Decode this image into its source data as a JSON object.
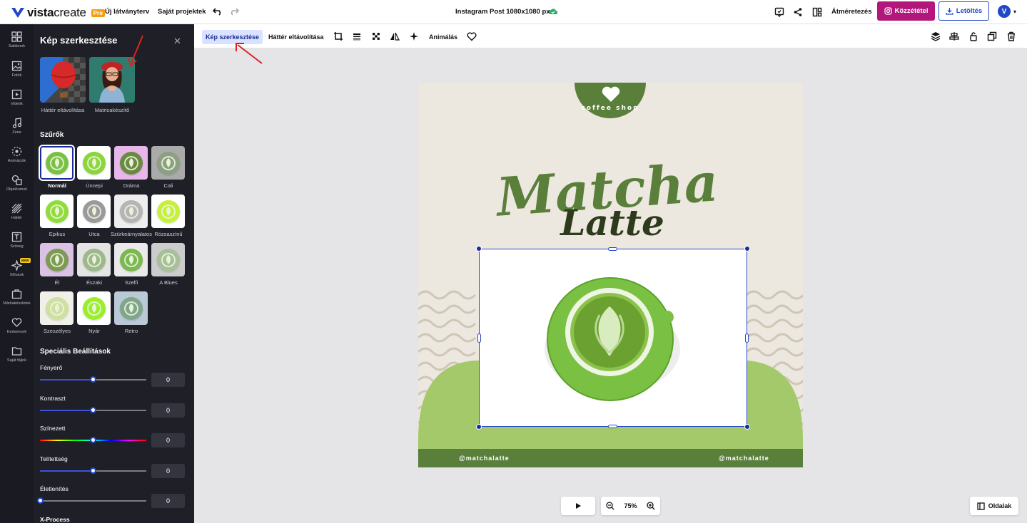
{
  "topbar": {
    "logo_main": "vista",
    "logo_sub": "create",
    "pro_badge": "Pro",
    "new_design": "Új látványterv",
    "my_projects": "Saját projektek",
    "doc_title": "Instagram Post 1080x1080 px",
    "resize": "Átméretezés",
    "publish": "Közzététel",
    "download": "Letöltés",
    "avatar_initial": "V"
  },
  "rail": {
    "items": [
      {
        "label": "Sablonok",
        "icon": "templates-icon"
      },
      {
        "label": "Fotók",
        "icon": "photos-icon"
      },
      {
        "label": "Videók",
        "icon": "videos-icon"
      },
      {
        "label": "Zene",
        "icon": "music-icon"
      },
      {
        "label": "Animációk",
        "icon": "animations-icon"
      },
      {
        "label": "Objektumok",
        "icon": "objects-icon"
      },
      {
        "label": "Háttér",
        "icon": "background-icon"
      },
      {
        "label": "Szöveg",
        "icon": "text-icon"
      },
      {
        "label": "Stílusok",
        "icon": "styles-icon"
      },
      {
        "label": "Márkakészletek",
        "icon": "brand-kits-icon"
      },
      {
        "label": "Kedvencek",
        "icon": "favorites-icon"
      },
      {
        "label": "Saját fájlok",
        "icon": "my-files-icon"
      }
    ],
    "new_badge": "NEW"
  },
  "panel": {
    "title": "Kép szerkesztése",
    "tools": [
      {
        "label": "Háttér eltávolítása"
      },
      {
        "label": "Matricakészítő"
      }
    ],
    "filters_title": "Szűrők",
    "filters": [
      {
        "label": "Normál",
        "selected": true
      },
      {
        "label": "Ünnepi"
      },
      {
        "label": "Dráma"
      },
      {
        "label": "Cali"
      },
      {
        "label": "Epikus"
      },
      {
        "label": "Utca"
      },
      {
        "label": "Szürkeárnyalatos"
      },
      {
        "label": "Rózsaszínű"
      },
      {
        "label": "Él"
      },
      {
        "label": "Északi"
      },
      {
        "label": "Szelfi"
      },
      {
        "label": "A Blues"
      },
      {
        "label": "Szeszélyes"
      },
      {
        "label": "Nyár"
      },
      {
        "label": "Retro"
      }
    ],
    "special_title": "Speciális Beállítások",
    "sliders": [
      {
        "label": "Fényerő",
        "value": "0",
        "position": 0.5
      },
      {
        "label": "Kontraszt",
        "value": "0",
        "position": 0.5
      },
      {
        "label": "Színezett",
        "value": "0",
        "position": 0.5
      },
      {
        "label": "Telítettség",
        "value": "0",
        "position": 0.5
      },
      {
        "label": "Életlenítés",
        "value": "0",
        "position": 0.0
      }
    ],
    "next_section": "X-Process"
  },
  "context_toolbar": {
    "edit_image": "Kép szerkesztése",
    "remove_bg": "Háttér eltávolítása",
    "animate": "Animálás"
  },
  "canvas": {
    "badge_text": "coffee shop",
    "title_line1": "Matcha",
    "title_line2": "Latte",
    "handle_left": "@matchalatte",
    "handle_right": "@matchalatte"
  },
  "bottom": {
    "zoom": "75%",
    "pages": "Oldalak"
  },
  "colors": {
    "accent": "#2148c9",
    "publish": "#b3177c",
    "brand_green": "#5a7f3b",
    "light_green": "#a3c96b"
  }
}
